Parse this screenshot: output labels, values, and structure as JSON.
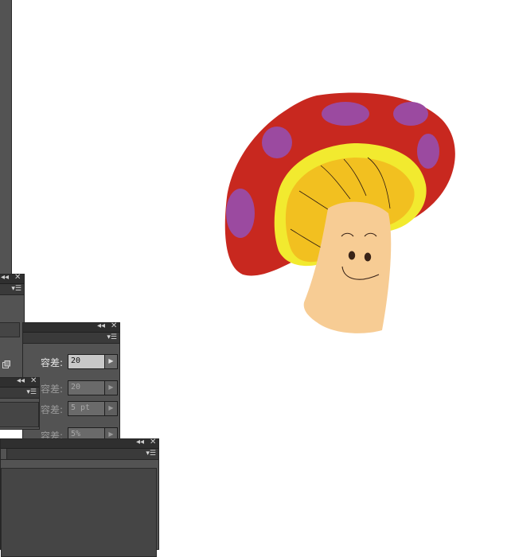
{
  "panels": {
    "collapse_glyph": "◂◂",
    "close_glyph": "✕",
    "menu_glyph": "▾☰",
    "arrow_glyph": "▶"
  },
  "tolerance": {
    "rows": [
      {
        "label": "容差:",
        "value": "20",
        "enabled": true
      },
      {
        "label": "容差:",
        "value": "20",
        "enabled": false
      },
      {
        "label": "容差:",
        "value": "5 pt",
        "enabled": false
      },
      {
        "label": "容差:",
        "value": "5%",
        "enabled": false
      }
    ]
  },
  "colors": {
    "canvas": "#ffffff",
    "panel": "#535353",
    "cap_red": "#c8281f",
    "cap_spot": "#9b4aa0",
    "rim_yellow": "#f2ea2f",
    "gill_yellow": "#f2c020",
    "stem": "#f7cc94",
    "face": "#3a2418"
  }
}
